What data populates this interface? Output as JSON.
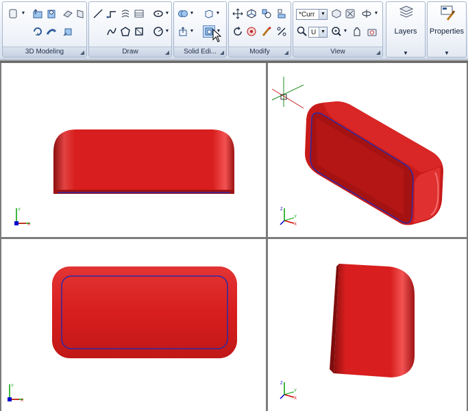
{
  "ribbon": {
    "panels": {
      "modeling": {
        "title": "3D Modeling"
      },
      "draw": {
        "title": "Draw"
      },
      "solid_editing": {
        "title": "Solid Edi..."
      },
      "modify": {
        "title": "Modify"
      },
      "view": {
        "title": "View",
        "visual_style_combo": "*Curr",
        "ucs_combo": "U"
      }
    },
    "layers_button": "Layers",
    "properties_button": "Properties",
    "launcher_glyph": "◢",
    "dropdown_glyph": "▼"
  },
  "viewports": {
    "top_left": {
      "view": "front",
      "ucs_icon": "ucs-2d-icon"
    },
    "top_right": {
      "view": "isometric",
      "ucs_icon": "ucs-3d-icon"
    },
    "bottom_left": {
      "view": "top",
      "ucs_icon": "ucs-2d-icon"
    },
    "bottom_right": {
      "view": "side",
      "ucs_icon": "ucs-3d-icon"
    }
  },
  "colors": {
    "solid_body": "#d81e1e",
    "solid_shadow": "#8c0f0f",
    "solid_highlight": "#f35252",
    "edge_blue": "#2a2aa6",
    "ribbon_bg": "#e6ecf5",
    "ucs_x": "#d40000",
    "ucs_y": "#00a000",
    "ucs_z": "#0000d0"
  }
}
